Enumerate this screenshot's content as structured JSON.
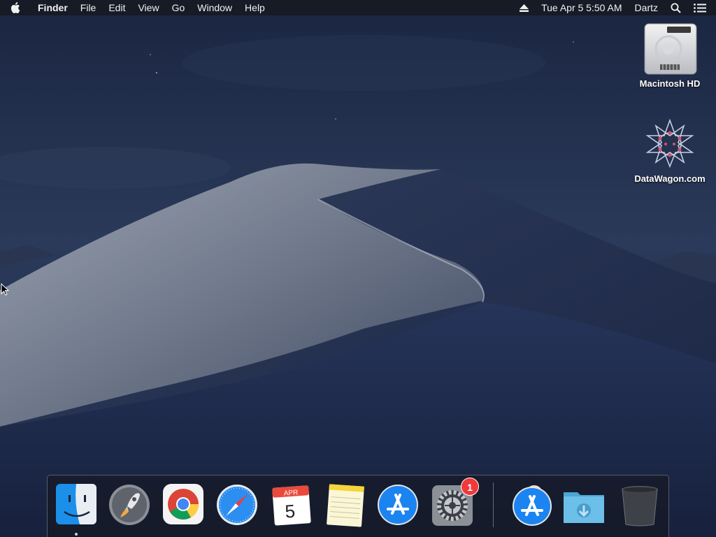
{
  "menubar": {
    "app_name": "Finder",
    "menus": [
      "File",
      "Edit",
      "View",
      "Go",
      "Window",
      "Help"
    ],
    "datetime": "Tue Apr 5  5:50 AM",
    "user": "Dartz",
    "icons": [
      "apple-icon",
      "eject-icon",
      "spotlight-search-icon",
      "notification-center-icon"
    ]
  },
  "desktop": {
    "icons": [
      {
        "label": "Macintosh HD",
        "icon": "hard-drive-icon"
      },
      {
        "label": "DataWagon.com",
        "icon": "datawagon-logo-icon"
      }
    ]
  },
  "dock": {
    "items": [
      {
        "name": "Finder",
        "icon": "finder-icon",
        "running": true
      },
      {
        "name": "Launchpad",
        "icon": "launchpad-icon"
      },
      {
        "name": "Google Chrome",
        "icon": "chrome-icon"
      },
      {
        "name": "Safari",
        "icon": "safari-icon"
      },
      {
        "name": "Calendar",
        "icon": "calendar-icon",
        "month": "APR",
        "day": "5"
      },
      {
        "name": "Notes",
        "icon": "notes-icon"
      },
      {
        "name": "App Store",
        "icon": "app-store-icon"
      },
      {
        "name": "System Preferences",
        "icon": "system-preferences-icon",
        "badge": "1"
      },
      {
        "name": "App Store",
        "icon": "app-store-icon"
      },
      {
        "name": "Downloads",
        "icon": "downloads-folder-icon"
      },
      {
        "name": "Trash",
        "icon": "trash-icon"
      }
    ]
  },
  "colors": {
    "badge": "#f03a3a",
    "sky": "#1d2a47",
    "dune_light": "#8e96a6"
  }
}
